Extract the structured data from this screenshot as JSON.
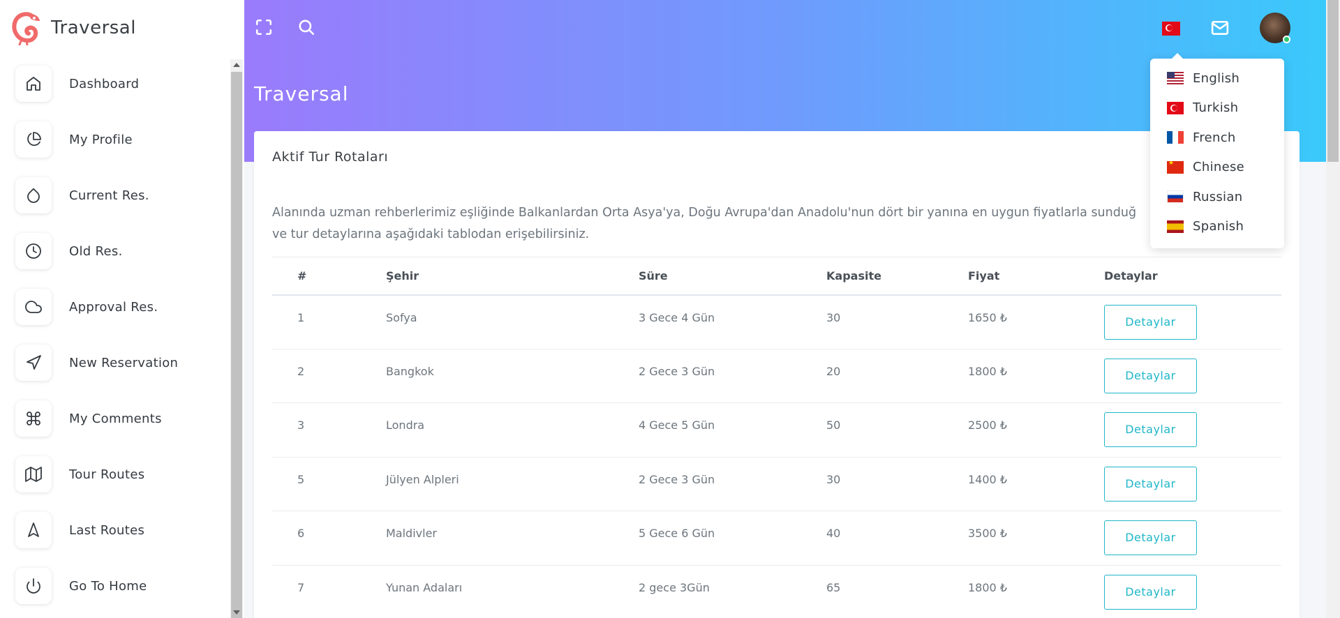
{
  "app": {
    "name": "Traversal"
  },
  "sidebar": {
    "items": [
      {
        "label": "Dashboard",
        "icon": "home-icon"
      },
      {
        "label": "My Profile",
        "icon": "pie-chart-icon"
      },
      {
        "label": "Current Res.",
        "icon": "droplet-icon"
      },
      {
        "label": "Old Res.",
        "icon": "clock-icon"
      },
      {
        "label": "Approval Res.",
        "icon": "cloud-icon"
      },
      {
        "label": "New Reservation",
        "icon": "send-icon"
      },
      {
        "label": "My Comments",
        "icon": "command-icon"
      },
      {
        "label": "Tour Routes",
        "icon": "map-icon"
      },
      {
        "label": "Last Routes",
        "icon": "navigation-icon"
      },
      {
        "label": "Go To Home",
        "icon": "power-icon"
      }
    ]
  },
  "header": {
    "page_title": "Traversal",
    "icons": [
      "fullscreen-icon",
      "search-icon",
      "turkey-flag-icon",
      "mail-icon"
    ]
  },
  "card": {
    "title": "Aktif Tur Rotaları",
    "description": "Alanında uzman rehberlerimiz eşliğinde Balkanlardan Orta Asya'ya, Doğu Avrupa'dan Anadolu'nun dört bir yanına en uygun fiyatlarla sunduğ\nve tur detaylarına aşağıdaki tablodan erişebilirsiniz."
  },
  "table": {
    "headers": [
      "#",
      "Şehir",
      "Süre",
      "Kapasite",
      "Fiyat",
      "Detaylar"
    ],
    "rows": [
      {
        "id": "1",
        "city": "Sofya",
        "duration": "3 Gece 4 Gün",
        "capacity": "30",
        "price": "1650 ₺",
        "button": "Detaylar"
      },
      {
        "id": "2",
        "city": "Bangkok",
        "duration": "2 Gece 3 Gün",
        "capacity": "20",
        "price": "1800 ₺",
        "button": "Detaylar"
      },
      {
        "id": "3",
        "city": "Londra",
        "duration": "4 Gece 5 Gün",
        "capacity": "50",
        "price": "2500 ₺",
        "button": "Detaylar"
      },
      {
        "id": "5",
        "city": "Jülyen Alpleri",
        "duration": "2 Gece 3 Gün",
        "capacity": "30",
        "price": "1400 ₺",
        "button": "Detaylar"
      },
      {
        "id": "6",
        "city": "Maldivler",
        "duration": "5 Gece 6 Gün",
        "capacity": "40",
        "price": "3500 ₺",
        "button": "Detaylar"
      },
      {
        "id": "7",
        "city": "Yunan Adaları",
        "duration": "2 gece 3Gün",
        "capacity": "65",
        "price": "1800 ₺",
        "button": "Detaylar"
      }
    ]
  },
  "language_menu": {
    "items": [
      {
        "label": "English",
        "flag": "flag-us"
      },
      {
        "label": "Turkish",
        "flag": "flag-tr"
      },
      {
        "label": "French",
        "flag": "flag-fr"
      },
      {
        "label": "Chinese",
        "flag": "flag-cn"
      },
      {
        "label": "Russian",
        "flag": "flag-ru"
      },
      {
        "label": "Spanish",
        "flag": "flag-es"
      }
    ]
  },
  "colors": {
    "gradient_start": "#9a7bfb",
    "gradient_end": "#3ac9fb",
    "button_accent": "#1fb6c8",
    "logo": "#f06a6a"
  }
}
